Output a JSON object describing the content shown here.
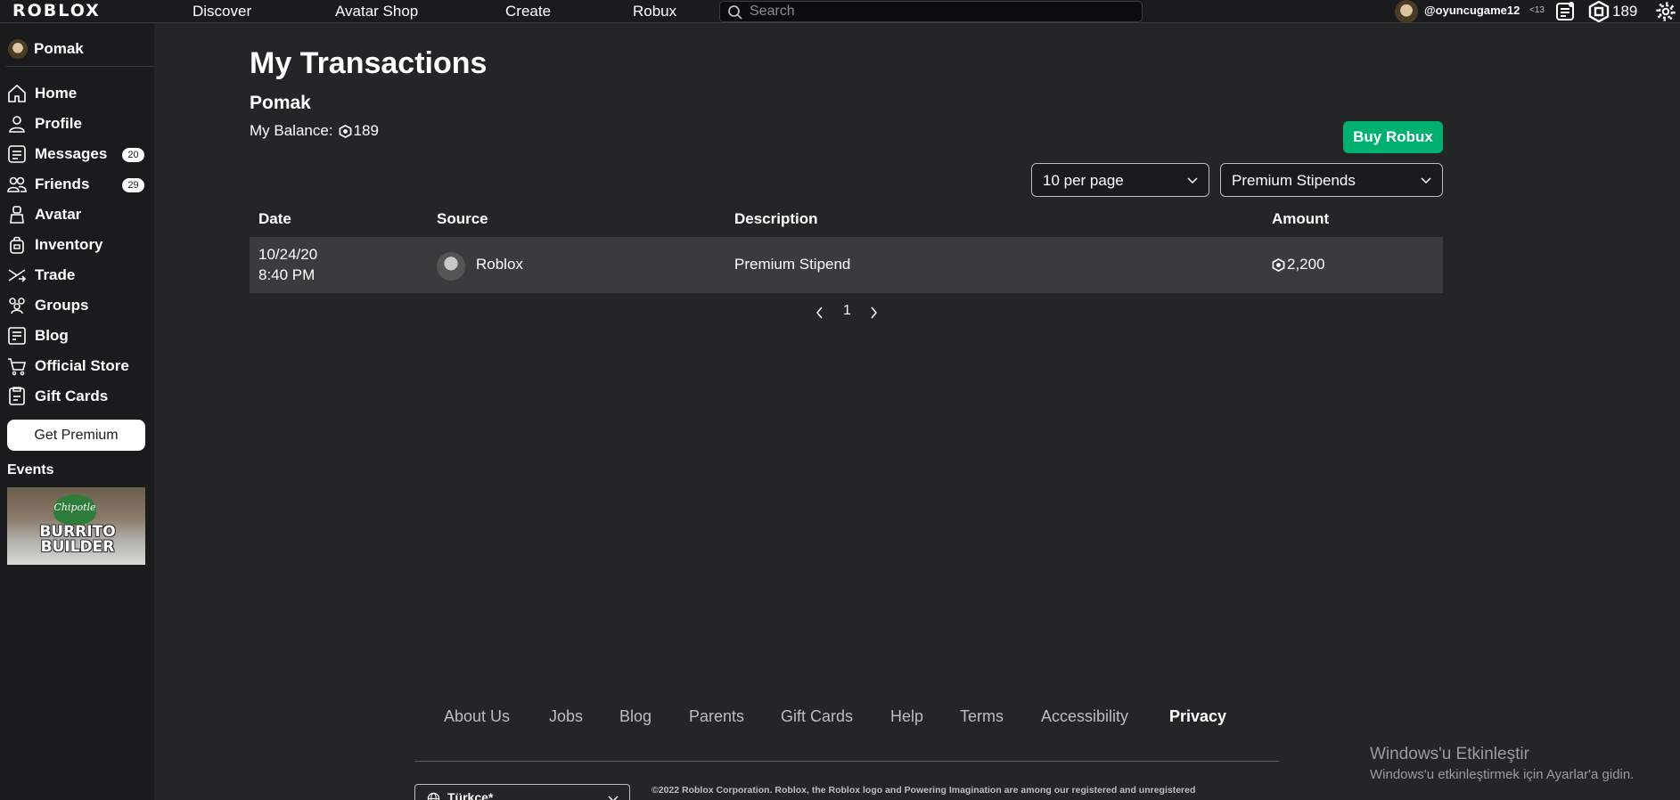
{
  "topbar": {
    "logo": "ROBLOX",
    "nav": [
      "Discover",
      "Avatar Shop",
      "Create",
      "Robux"
    ],
    "search_placeholder": "Search",
    "username": "@oyuncugame12",
    "age": "<13",
    "robux": "189"
  },
  "sidebar": {
    "user": "Pomak",
    "items": [
      {
        "label": "Home",
        "icon": "home-icon"
      },
      {
        "label": "Profile",
        "icon": "profile-icon"
      },
      {
        "label": "Messages",
        "icon": "messages-icon",
        "badge": "20"
      },
      {
        "label": "Friends",
        "icon": "friends-icon",
        "badge": "29"
      },
      {
        "label": "Avatar",
        "icon": "avatar-icon"
      },
      {
        "label": "Inventory",
        "icon": "inventory-icon"
      },
      {
        "label": "Trade",
        "icon": "trade-icon"
      },
      {
        "label": "Groups",
        "icon": "groups-icon"
      },
      {
        "label": "Blog",
        "icon": "blog-icon"
      },
      {
        "label": "Official Store",
        "icon": "store-icon"
      },
      {
        "label": "Gift Cards",
        "icon": "gift-card-icon"
      }
    ],
    "premium_button": "Get Premium",
    "events_label": "Events",
    "event_banner": {
      "brand": "Chipotle",
      "title": "BURRITO BUILDER"
    }
  },
  "main": {
    "title": "My Transactions",
    "user": "Pomak",
    "balance_label": "My Balance:",
    "balance_value": "189",
    "buy_robux": "Buy Robux",
    "per_page": "10 per page",
    "transaction_type": "Premium Stipends",
    "columns": [
      "Date",
      "Source",
      "Description",
      "Amount"
    ],
    "rows": [
      {
        "date": "10/24/20",
        "time": "8:40 PM",
        "source": "Roblox",
        "description": "Premium Stipend",
        "amount": "2,200"
      }
    ],
    "page": "1"
  },
  "footer": {
    "links": [
      "About Us",
      "Jobs",
      "Blog",
      "Parents",
      "Gift Cards",
      "Help",
      "Terms",
      "Accessibility",
      "Privacy"
    ],
    "language": "Türkçe*",
    "copyright": "©2022 Roblox Corporation. Roblox, the Roblox logo and Powering Imagination are among our registered and unregistered"
  },
  "watermark": {
    "title": "Windows'u Etkinleştir",
    "subtitle": "Windows'u etkinleştirmek için Ayarlar'a gidin."
  },
  "colors": {
    "accent_green": "#00b06f",
    "background": "#232527",
    "sidebar": "#191b1d"
  }
}
